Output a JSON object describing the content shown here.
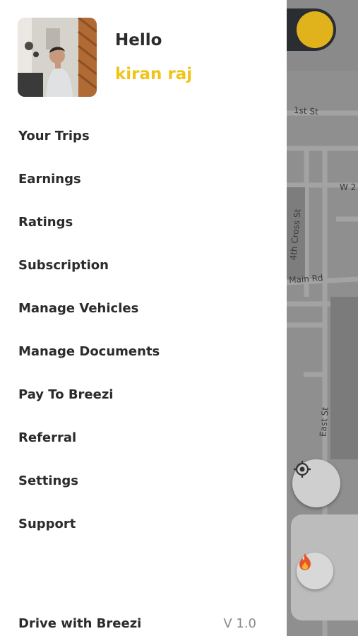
{
  "header": {
    "greeting": "Hello",
    "username": "kiran raj"
  },
  "menu": {
    "items": [
      {
        "label": "Your Trips"
      },
      {
        "label": "Earnings"
      },
      {
        "label": "Ratings"
      },
      {
        "label": "Subscription"
      },
      {
        "label": "Manage Vehicles"
      },
      {
        "label": "Manage Documents"
      },
      {
        "label": "Pay To Breezi"
      },
      {
        "label": "Referral"
      },
      {
        "label": "Settings"
      },
      {
        "label": "Support"
      }
    ]
  },
  "footer": {
    "label": "Drive with Breezi",
    "version": "V 1.0"
  },
  "map": {
    "streets": {
      "first": "1st St",
      "w2": "W 2",
      "fourth_cross": "4th Cross St",
      "main_rd": "i Main Rd",
      "east": "East St"
    },
    "icons": [
      "locate-icon",
      "fire-icon"
    ]
  },
  "colors": {
    "accent": "#f0c419",
    "toggle_bg": "#2a2e33",
    "toggle_knob": "#e0b21b",
    "text": "#2b2b2b"
  }
}
